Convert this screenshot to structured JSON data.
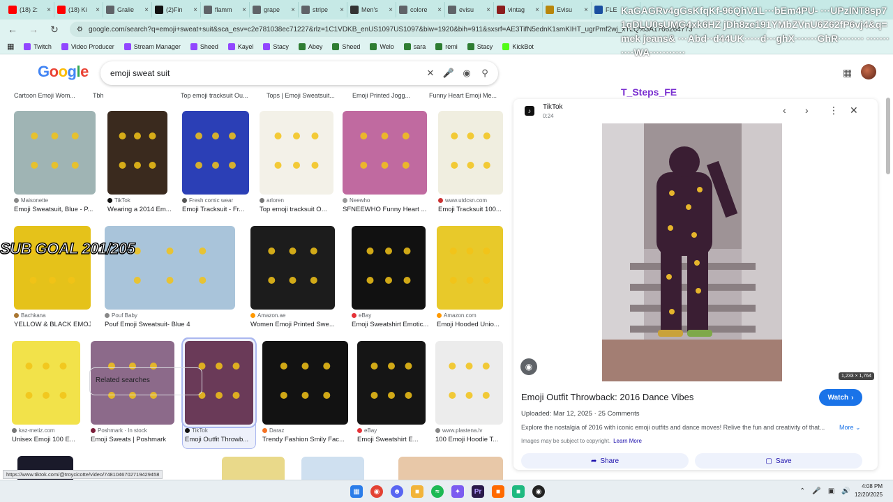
{
  "browser": {
    "tabs": [
      {
        "label": "(18) 2:",
        "color": "#ff0000",
        "icon": "youtube-icon"
      },
      {
        "label": "(18) Ki",
        "color": "#ff0000",
        "icon": "youtube-icon"
      },
      {
        "label": "Gralie",
        "color": "#5f6368",
        "icon": "google-icon"
      },
      {
        "label": "(2)Fin",
        "color": "#111111",
        "icon": "tiktok-icon"
      },
      {
        "label": "flamm",
        "color": "#5f6368",
        "icon": "google-icon"
      },
      {
        "label": "grape",
        "color": "#5f6368",
        "icon": "google-icon"
      },
      {
        "label": "stripe",
        "color": "#5f6368",
        "icon": "google-icon"
      },
      {
        "label": "Men's",
        "color": "#333333",
        "icon": "store-icon"
      },
      {
        "label": "colore",
        "color": "#5f6368",
        "icon": "google-icon"
      },
      {
        "label": "evisu",
        "color": "#5f6368",
        "icon": "google-icon"
      },
      {
        "label": "vintag",
        "color": "#8b1d1d",
        "icon": "store-icon"
      },
      {
        "label": "Evisu",
        "color": "#b8860b",
        "icon": "store-icon"
      },
      {
        "label": "FLE",
        "color": "#1a4fa0",
        "icon": "store-icon"
      }
    ],
    "url": "google.com/search?q=emoji+sweat+suit&sca_esv=c2e781038ec71227&rlz=1C1VDKB_enUS1097US1097&biw=1920&bih=911&sxsrf=AE3TifN5ednK1smKIHT_ugrPmf2wj_xTLQ%3A1766264773",
    "bookmarks": [
      {
        "label": "Twitch",
        "color": "#9146ff"
      },
      {
        "label": "Video Producer",
        "color": "#9146ff"
      },
      {
        "label": "Stream Manager",
        "color": "#9146ff"
      },
      {
        "label": "Sheed",
        "color": "#9146ff"
      },
      {
        "label": "Kayel",
        "color": "#9146ff"
      },
      {
        "label": "Stacy",
        "color": "#9146ff"
      },
      {
        "label": "Abey",
        "color": "#2e7d32"
      },
      {
        "label": "Sheed",
        "color": "#2e7d32"
      },
      {
        "label": "Welo",
        "color": "#2e7d32"
      },
      {
        "label": "sara",
        "color": "#2e7d32"
      },
      {
        "label": "remi",
        "color": "#2e7d32"
      },
      {
        "label": "Stacy",
        "color": "#2e7d32"
      },
      {
        "label": "KickBot",
        "color": "#53fc18"
      }
    ]
  },
  "search": {
    "logo_letters": [
      "G",
      "o",
      "o",
      "g",
      "l",
      "e"
    ],
    "query": "emoji sweat suit"
  },
  "results": {
    "top_titles": [
      "Cartoon Emoji Wom...",
      "Tbh",
      "Top emoji tracksuit Ou...",
      "Tops | Emoji Sweatsuit...",
      "Emoji Printed Jogg...",
      "Funny Heart Emoji Me..."
    ],
    "items": [
      {
        "source": "Maisonette",
        "caption": "Emoji Sweatsuit, Blue - P...",
        "color": "#9fb4b4",
        "dot": "#888888"
      },
      {
        "source": "TikTok",
        "caption": "Wearing a 2014 Em...",
        "color": "#3a2a1e",
        "dot": "#111111"
      },
      {
        "source": "Fresh comic wear",
        "caption": "Emoji Tracksuit - Fr...",
        "color": "#2b3fb6",
        "dot": "#555555"
      },
      {
        "source": "arloren",
        "caption": "Top emoji tracksuit O...",
        "color": "#f3f1e8",
        "dot": "#777777"
      },
      {
        "source": "Neewho",
        "caption": "SFNEEWHO Funny Heart ...",
        "color": "#c06aa0",
        "dot": "#999999"
      },
      {
        "source": "www.utdcsn.com",
        "caption": "Emoji Tracksuit 100...",
        "color": "#f0eee0",
        "dot": "#cc3333"
      },
      {
        "source": "Bachkana",
        "caption": "YELLOW & BLACK EMOJ...",
        "color": "#e5c21a",
        "dot": "#aa7733"
      },
      {
        "source": "Pouf Baby",
        "caption": "Pouf Emoji Sweatsuit- Blue 4",
        "color": "#a9c4da",
        "dot": "#888888"
      },
      {
        "source": "Amazon.ae",
        "caption": "Women Emoji Printed Swe...",
        "color": "#1c1c1c",
        "dot": "#ff9900"
      },
      {
        "source": "eBay",
        "caption": "Emoji Sweatshirt Emotic...",
        "color": "#111111",
        "dot": "#e53238"
      },
      {
        "source": "Amazon.com",
        "caption": "Emoji Hooded Unio...",
        "color": "#e8c92a",
        "dot": "#ff9900"
      },
      {
        "source": "kaz-metiz.com",
        "caption": "Unisex Emoji 100 E...",
        "color": "#f2e24a",
        "dot": "#777777"
      },
      {
        "source": "Poshmark · In stock",
        "caption": "Emoji Sweats | Poshmark",
        "color": "#8c6a8a",
        "dot": "#7b1e3a"
      },
      {
        "source": "TikTok",
        "caption": "Emoji Outfit Throwb...",
        "color": "#6a3a58",
        "dot": "#111111"
      },
      {
        "source": "Daraz",
        "caption": "Trendy Fashion Smily Fac...",
        "color": "#121212",
        "dot": "#f57224"
      },
      {
        "source": "eBay",
        "caption": "Emoji Sweatshirt E...",
        "color": "#151515",
        "dot": "#e53238"
      },
      {
        "source": "www.plastena.lv",
        "caption": "100 Emoji Hoodie T...",
        "color": "#ececec",
        "dot": "#888888"
      }
    ],
    "related_label": "Related searches"
  },
  "panel": {
    "source": "TikTok",
    "duration": "0:24",
    "image_dims": "1,233 × 1,764",
    "title": "Emoji Outfit Throwback: 2016 Dance Vibes",
    "watch_label": "Watch",
    "meta": "Uploaded: Mar 12, 2025 · 25 Comments",
    "description": "Explore the nostalgia of 2016 with iconic emoji outfits and dance moves! Relive the fun and creativity of that...",
    "more_label": "More",
    "copyright": "Images may be subject to copyright.",
    "learn_more": "Learn More",
    "share_label": "Share",
    "save_label": "Save"
  },
  "overlays": {
    "sub_goal": "SUB GOAL 201/205",
    "chat_text": "KaGAGRv4gGsKfqKf-96QhV1L···bEm4PU- ···UPzINT8sp71qDLU0sUMG4xk6HZ jDh8ze191YMbZVnU6Z62fP6vj4&q=mek jeans& ···Abd··d44UK·····d···ghX·······GhR········ ···········WA···········",
    "chat_tag": "T_Steps_FE"
  },
  "status_url": "https://www.tiktok.com/@troycicotte/video/7481046702719429458",
  "taskbar": {
    "time": "4:08 PM",
    "date": "12/20/2025"
  }
}
